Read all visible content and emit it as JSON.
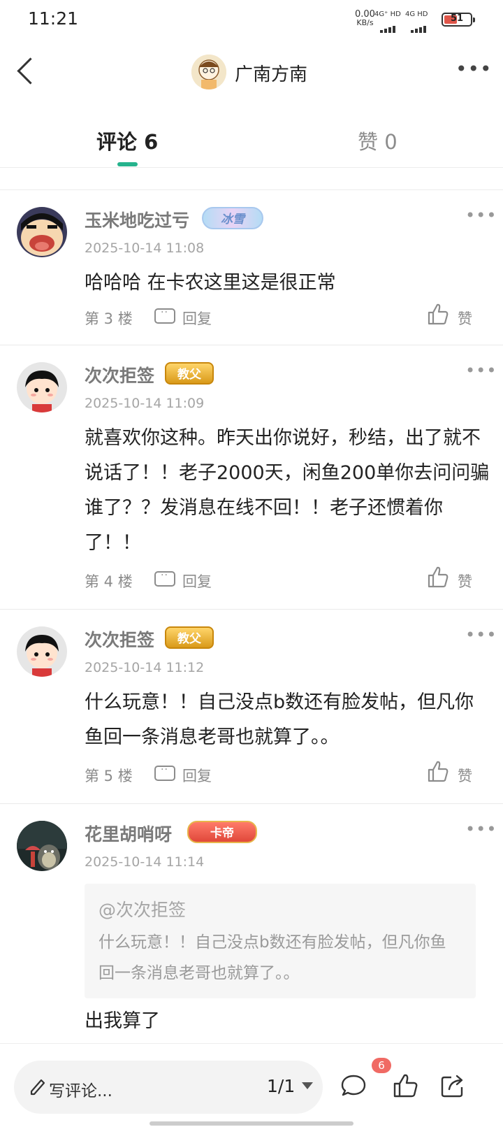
{
  "status_bar": {
    "time": "11:21",
    "net_speed": "0.00",
    "net_speed_unit": "KB/s",
    "signal1_label": "4G⁺ HD",
    "signal2_label": "4G HD",
    "battery": "51"
  },
  "header": {
    "title": "广南方南"
  },
  "tabs": {
    "comments_label": "评论 6",
    "likes_label": "赞 0"
  },
  "comments": [
    {
      "user": "玉米地吃过亏",
      "badge": "冰雪",
      "time": "2025-10-14 11:08",
      "text": "哈哈哈 在卡农这里这是很正常",
      "floor": "第 3 楼",
      "reply_label": "回复",
      "like_label": "赞"
    },
    {
      "user": "次次拒签",
      "badge": "教父",
      "time": "2025-10-14 11:09",
      "text": "就喜欢你这种。昨天出你说好，秒结，出了就不说话了！！老子2000天，闲鱼200单你去问问骗谁了？？发消息在线不回！！老子还惯着你了！！",
      "floor": "第 4 楼",
      "reply_label": "回复",
      "like_label": "赞"
    },
    {
      "user": "次次拒签",
      "badge": "教父",
      "time": "2025-10-14 11:12",
      "text": "什么玩意！！自己没点b数还有脸发帖，但凡你鱼回一条消息老哥也就算了。。",
      "floor": "第 5 楼",
      "reply_label": "回复",
      "like_label": "赞"
    },
    {
      "user": "花里胡哨呀",
      "badge": "卡帝",
      "time": "2025-10-14 11:14",
      "quote_user": "@次次拒签",
      "quote_text": "什么玩意！！自己没点b数还有脸发帖，但凡你鱼回一条消息老哥也就算了。。",
      "text": "出我算了"
    }
  ],
  "bottom_bar": {
    "write_placeholder": "写评论...",
    "page_indicator": "1/1",
    "comment_count": "6"
  },
  "colors": {
    "accent": "#26b38d",
    "badge_red": "#f06a64",
    "text_primary": "#222222",
    "text_secondary": "#8c8c8c"
  }
}
